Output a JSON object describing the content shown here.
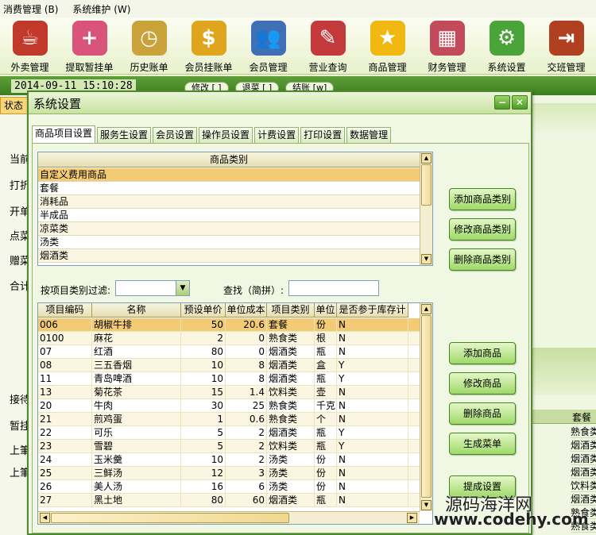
{
  "menubar": [
    "消费管理 (B)",
    "系统维护 (W)"
  ],
  "toolbar": [
    {
      "label": "外卖管理",
      "icon": "takeout-icon",
      "color": "#c0392b",
      "glyph": "☕"
    },
    {
      "label": "提取暂挂单",
      "icon": "plus-bill-icon",
      "color": "#d9537a",
      "glyph": "+"
    },
    {
      "label": "历史账单",
      "icon": "clock-icon",
      "color": "#c9a23a",
      "glyph": "◷"
    },
    {
      "label": "会员挂账单",
      "icon": "money-arrow-icon",
      "color": "#e0a51c",
      "glyph": "$"
    },
    {
      "label": "会员管理",
      "icon": "members-icon",
      "color": "#3f6fb5",
      "glyph": "👥"
    },
    {
      "label": "营业查询",
      "icon": "notebook-icon",
      "color": "#c43a3a",
      "glyph": "✎"
    },
    {
      "label": "商品管理",
      "icon": "star-icon",
      "color": "#f0b810",
      "glyph": "★"
    },
    {
      "label": "财务管理",
      "icon": "calculator-icon",
      "color": "#c24a5a",
      "glyph": "▦"
    },
    {
      "label": "系统设置",
      "icon": "gear-icon",
      "color": "#4aa43a",
      "glyph": "⚙"
    },
    {
      "label": "交班管理",
      "icon": "exit-icon",
      "color": "#b04020",
      "glyph": "⇥"
    }
  ],
  "datetime": "2014-09-11 15:10:28",
  "bg_tabs": [
    "修改 [ ]",
    "退菜 [ ]",
    "结账 [w]"
  ],
  "left_panel": {
    "status": "状态",
    "items": [
      "当前",
      "打折",
      "开单",
      "点菜",
      "赠菜",
      "合计"
    ],
    "items2": [
      "接待",
      "暂挂",
      "上筆",
      "上筆"
    ]
  },
  "dialog": {
    "title": "系统设置",
    "tabs": [
      "商品项目设置",
      "服务生设置",
      "会员设置",
      "操作员设置",
      "计费设置",
      "打印设置",
      "数据管理"
    ],
    "category_grid": {
      "header": "商品类别",
      "rows": [
        "自定义费用商品",
        "套餐",
        "消耗品",
        "半成品",
        "凉菜类",
        "汤类",
        "烟酒类"
      ]
    },
    "category_buttons": [
      "添加商品类别",
      "修改商品类别",
      "删除商品类别"
    ],
    "filter_label": "按项目类别过滤:",
    "search_label": "查找（简拼）:",
    "product_grid": {
      "columns": [
        "项目编码",
        "名称",
        "预设单价",
        "单位成本",
        "项目类别",
        "单位",
        "是否参于库存计"
      ],
      "rows": [
        [
          "006",
          "胡椒牛排",
          "50",
          "20.6",
          "套餐",
          "份",
          "N"
        ],
        [
          "0100",
          "麻花",
          "2",
          "0",
          "熟食类",
          "根",
          "N"
        ],
        [
          "07",
          "红酒",
          "80",
          "0",
          "烟酒类",
          "瓶",
          "N"
        ],
        [
          "08",
          "三五香烟",
          "10",
          "8",
          "烟酒类",
          "盒",
          "Y"
        ],
        [
          "11",
          "青岛啤酒",
          "10",
          "8",
          "烟酒类",
          "瓶",
          "Y"
        ],
        [
          "13",
          "菊花茶",
          "15",
          "1.4",
          "饮料类",
          "壶",
          "N"
        ],
        [
          "20",
          "牛肉",
          "30",
          "25",
          "熟食类",
          "千克",
          "N"
        ],
        [
          "21",
          "煎鸡蛋",
          "1",
          "0.6",
          "熟食类",
          "个",
          "N"
        ],
        [
          "22",
          "可乐",
          "5",
          "2",
          "烟酒类",
          "瓶",
          "Y"
        ],
        [
          "23",
          "雪碧",
          "5",
          "2",
          "饮料类",
          "瓶",
          "Y"
        ],
        [
          "24",
          "玉米羹",
          "10",
          "2",
          "汤类",
          "份",
          "N"
        ],
        [
          "25",
          "三鲜汤",
          "12",
          "3",
          "汤类",
          "份",
          "N"
        ],
        [
          "26",
          "美人汤",
          "16",
          "6",
          "汤类",
          "份",
          "N"
        ],
        [
          "27",
          "黑土地",
          "80",
          "60",
          "烟酒类",
          "瓶",
          "N"
        ]
      ]
    },
    "product_buttons": [
      "添加商品",
      "修改商品",
      "删除商品",
      "生成菜单",
      "提成设置"
    ]
  },
  "right_panel": {
    "header": "套餐",
    "cells": [
      "熟食类",
      "烟酒类",
      "烟酒类",
      "烟酒类",
      "饮料类",
      "烟酒类",
      "熟食类",
      "熟食类"
    ]
  },
  "watermark": {
    "line1": "源码海洋网",
    "line2": "www.codehy.com"
  }
}
